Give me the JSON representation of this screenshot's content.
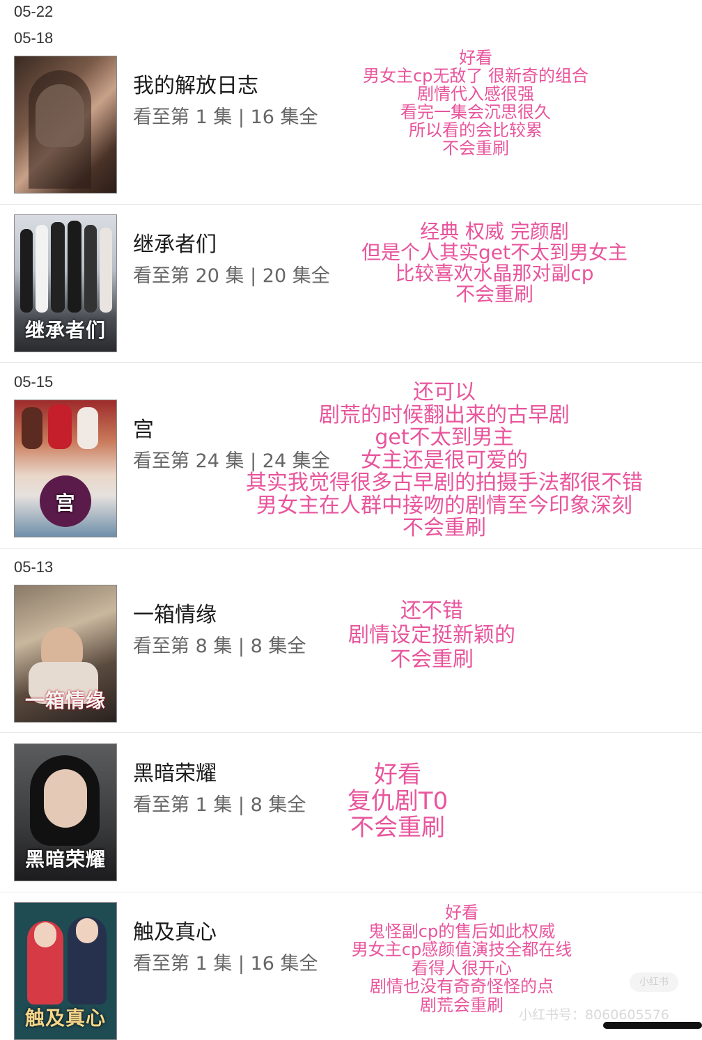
{
  "dates": {
    "d0522": "05-22",
    "d0518": "05-18",
    "d0515": "05-15",
    "d0513": "05-13"
  },
  "items": [
    {
      "title": "我的解放日志",
      "progress": "看至第 1 集 | 16 集全",
      "poster_caption": "",
      "note": [
        "好看",
        "男女主cp无敌了 很新奇的组合",
        "剧情代入感很强",
        "看完一集会沉思很久",
        "所以看的会比较累",
        "不会重刷"
      ]
    },
    {
      "title": "继承者们",
      "progress": "看至第 20 集 | 20 集全",
      "poster_caption": "继承者们",
      "note": [
        "经典 权威 完颜剧",
        "但是个人其实get不太到男女主",
        "比较喜欢水晶那对副cp",
        "不会重刷"
      ]
    },
    {
      "title": "宫",
      "progress": "看至第 24 集 | 24 集全",
      "poster_caption": "宫",
      "note": [
        "还可以",
        "剧荒的时候翻出来的古早剧",
        "get不太到男主",
        "女主还是很可爱的",
        "其实我觉得很多古早剧的拍摄手法都很不错",
        "男女主在人群中接吻的剧情至今印象深刻",
        "不会重刷"
      ]
    },
    {
      "title": "一箱情缘",
      "progress": "看至第 8 集 | 8 集全",
      "poster_caption": "一箱情缘",
      "note": [
        "还不错",
        "剧情设定挺新颖的",
        "不会重刷"
      ]
    },
    {
      "title": "黑暗荣耀",
      "progress": "看至第 1 集 | 8 集全",
      "poster_caption": "黑暗荣耀",
      "note": [
        "好看",
        "复仇剧T0",
        "不会重刷"
      ]
    },
    {
      "title": "触及真心",
      "progress": "看至第 1 集 | 16 集全",
      "poster_caption": "触及真心",
      "note": [
        "好看",
        "鬼怪副cp的售后如此权威",
        "男女主cp感颜值演技全都在线",
        "看得人很开心",
        "剧情也没有奇奇怪怪的点",
        "剧荒会重刷"
      ]
    }
  ],
  "watermark": "小红书号：8060605576",
  "watermark_badge": "小红书"
}
